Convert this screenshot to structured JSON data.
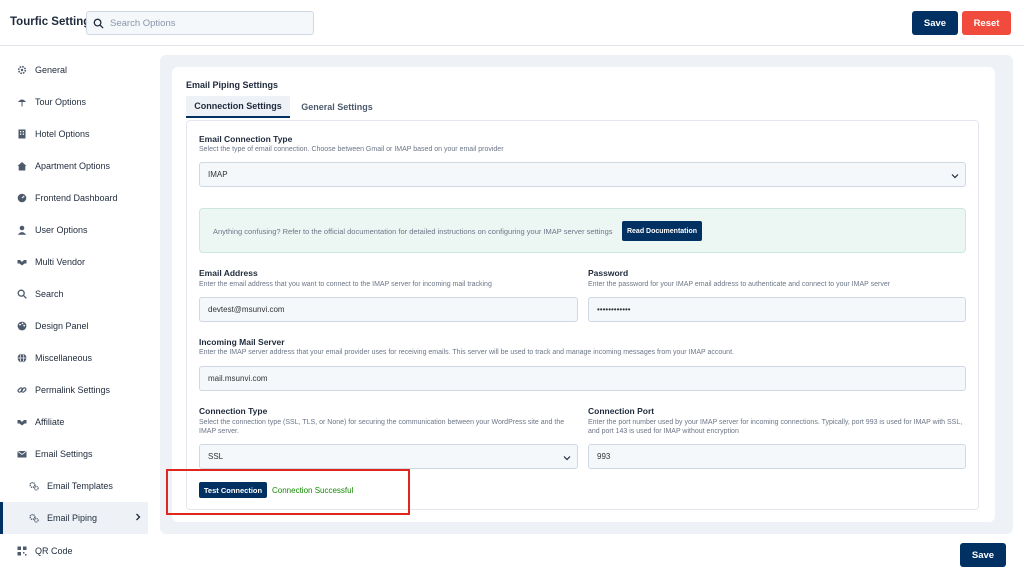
{
  "header": {
    "title": "Tourfic Settings",
    "search_placeholder": "Search Options",
    "save_label": "Save",
    "reset_label": "Reset"
  },
  "sidebar": {
    "items": [
      {
        "label": "General",
        "icon": "gear-icon"
      },
      {
        "label": "Tour Options",
        "icon": "beach-umbrella-icon"
      },
      {
        "label": "Hotel Options",
        "icon": "building-icon"
      },
      {
        "label": "Apartment Options",
        "icon": "house-icon"
      },
      {
        "label": "Frontend Dashboard",
        "icon": "dashboard-icon"
      },
      {
        "label": "User Options",
        "icon": "user-icon"
      },
      {
        "label": "Multi Vendor",
        "icon": "handshake-icon"
      },
      {
        "label": "Search",
        "icon": "search-icon"
      },
      {
        "label": "Design Panel",
        "icon": "palette-icon"
      },
      {
        "label": "Miscellaneous",
        "icon": "globe-icon"
      },
      {
        "label": "Permalink Settings",
        "icon": "link-icon"
      },
      {
        "label": "Affiliate",
        "icon": "handshake-icon"
      },
      {
        "label": "Email Settings",
        "icon": "envelope-icon"
      },
      {
        "label": "Email Templates",
        "icon": "gears-icon"
      },
      {
        "label": "Email Piping",
        "icon": "gears-icon"
      },
      {
        "label": "QR Code",
        "icon": "qr-code-icon"
      }
    ],
    "active_index": 14
  },
  "main": {
    "section_title": "Email Piping Settings",
    "tabs": [
      {
        "label": "Connection Settings",
        "active": true
      },
      {
        "label": "General Settings",
        "active": false
      }
    ],
    "connection_type": {
      "label": "Email Connection Type",
      "description": "Select the type of email connection. Choose between Gmail or IMAP based on your email provider",
      "value": "IMAP"
    },
    "notice": {
      "text": "Anything confusing? Refer to the official documentation for detailed instructions on configuring your IMAP server settings",
      "button_label": "Read Documentation"
    },
    "email_address": {
      "label": "Email Address",
      "description": "Enter the email address that you want to connect to the IMAP server for incoming mail tracking",
      "value": "devtest@msunvi.com"
    },
    "password": {
      "label": "Password",
      "description": "Enter the password for your IMAP email address to authenticate and connect to your IMAP server",
      "value": "••••••••••••"
    },
    "incoming_server": {
      "label": "Incoming Mail Server",
      "description": "Enter the IMAP server address that your email provider uses for receiving emails. This server will be used to track and manage incoming messages from your IMAP account.",
      "value": "mail.msunvi.com"
    },
    "connection_security": {
      "label": "Connection Type",
      "description": "Select the connection type (SSL, TLS, or None) for securing the communication between your WordPress site and the IMAP server.",
      "value": "SSL"
    },
    "connection_port": {
      "label": "Connection Port",
      "description": "Enter the port number used by your IMAP server for incoming connections. Typically, port 993 is used for IMAP with SSL, and port 143 is used for IMAP without encryption",
      "value": "993"
    },
    "test_button_label": "Test Connection",
    "test_status": "Connection Successful"
  },
  "footer": {
    "save_label": "Save"
  },
  "colors": {
    "primary": "#003162",
    "danger": "#f04b3c",
    "success": "#138a00",
    "highlight": "#e0271f"
  }
}
